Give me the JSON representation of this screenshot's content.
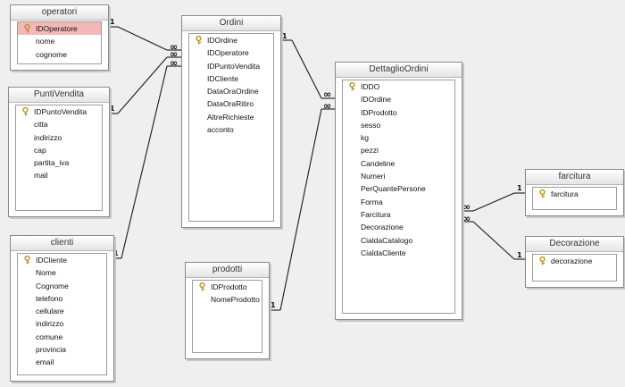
{
  "tables": {
    "operatori": {
      "title": "operatori",
      "fields": [
        "IDOperatore",
        "nome",
        "cognome"
      ],
      "key_field": "IDOperatore",
      "selected_field": "IDOperatore"
    },
    "puntivendita": {
      "title": "PuntiVendita",
      "fields": [
        "IDPuntoVendita",
        "citta",
        "indirizzo",
        "cap",
        "partita_iva",
        "mail"
      ],
      "key_field": "IDPuntoVendita"
    },
    "clienti": {
      "title": "clienti",
      "fields": [
        "IDCliente",
        "Nome",
        "Cognome",
        "telefono",
        "cellulare",
        "indirizzo",
        "comune",
        "provincia",
        "email"
      ],
      "key_field": "IDCliente"
    },
    "ordini": {
      "title": "Ordini",
      "fields": [
        "IDOrdine",
        "IDOperatore",
        "IDPuntoVendita",
        "IDCliente",
        "DataOraOrdine",
        "DataOraRitiro",
        "AltreRichieste",
        "acconto"
      ],
      "key_field": "IDOrdine"
    },
    "prodotti": {
      "title": "prodotti",
      "fields": [
        "IDProdotto",
        "NomeProdotto"
      ],
      "key_field": "IDProdotto"
    },
    "dettaglio": {
      "title": "DettaglioOrdini",
      "fields": [
        "IDDO",
        "IDOrdine",
        "IDProdotto",
        "sesso",
        "kg",
        "pezzi",
        "Candeline",
        "Numeri",
        "PerQuantePersone",
        "Forma",
        "Farcitura",
        "Decorazione",
        "CialdaCatalogo",
        "CialdaCliente"
      ],
      "key_field": "IDDO"
    },
    "farcitura": {
      "title": "farcitura",
      "fields": [
        "farcitura"
      ],
      "key_field": "farcitura"
    },
    "decorazione": {
      "title": "Decorazione",
      "fields": [
        "decorazione"
      ],
      "key_field": "decorazione"
    }
  },
  "relationships": [
    {
      "from": "operatori",
      "to": "ordini",
      "from_card": "1",
      "to_card": "∞"
    },
    {
      "from": "puntivendita",
      "to": "ordini",
      "from_card": "1",
      "to_card": "∞"
    },
    {
      "from": "clienti",
      "to": "ordini",
      "from_card": "1",
      "to_card": "∞"
    },
    {
      "from": "ordini",
      "to": "dettaglio",
      "from_card": "1",
      "to_card": "∞"
    },
    {
      "from": "prodotti",
      "to": "dettaglio",
      "from_card": "1",
      "to_card": "∞"
    },
    {
      "from": "farcitura",
      "to": "dettaglio",
      "from_card": "1",
      "to_card": "∞"
    },
    {
      "from": "decorazione",
      "to": "dettaglio",
      "from_card": "1",
      "to_card": "∞"
    }
  ],
  "colors": {
    "selected_field": "#f6b7b7",
    "background": "#efefef",
    "key_icon": "#c9a227"
  }
}
